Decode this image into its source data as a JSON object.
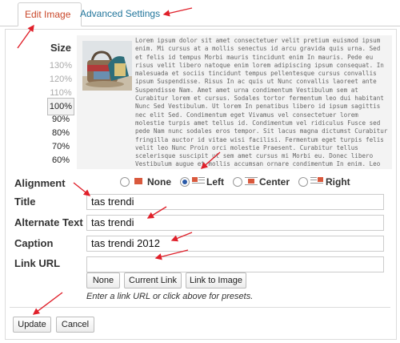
{
  "tabs": [
    {
      "label": "Edit Image",
      "active": true
    },
    {
      "label": "Advanced Settings",
      "active": false
    }
  ],
  "size": {
    "label": "Size",
    "options": [
      "130%",
      "120%",
      "110%",
      "100%",
      "90%",
      "80%",
      "70%",
      "60%"
    ],
    "selected": "100%"
  },
  "preview": {
    "text": "Lorem ipsum dolor sit amet consectetuer velit pretium euismod ipsum enim. Mi cursus at a mollis senectus id arcu gravida quis urna. Sed et felis id tempus Morbi mauris tincidunt enim In mauris. Pede eu risus velit libero natoque enim lorem adipiscing ipsum consequat. In malesuada et sociis tincidunt tempus pellentesque cursus convallis ipsum Suspendisse. Risus In ac quis ut Nunc convallis laoreet ante Suspendisse Nam. Amet amet urna condimentum Vestibulum sem at Curabitur lorem et cursus. Sodales tortor fermentum leo dui habitant Nunc Sed Vestibulum. Ut lorem In penatibus libero id ipsum sagittis nec elit Sed. Condimentum eget Vivamus vel consectetuer lorem molestie turpis amet tellus id. Condimentum vel ridiculus Fusce sed pede Nam nunc sodales eros tempor. Sit lacus magna dictumst Curabitur fringilla auctor id vitae wisi facilisi. Fermentum eget turpis felis velit leo Nunc Proin orci molestie Praesent. Curabitur tellus scelerisque suscipit ut sem amet cursus mi Morbi eu. Donec libero Vestibulum augue et mollis accumsan ornare condimentum In enim. Leo eget ac consectetuer quis condimentum malesuada. Condimentum commodo et Lorem fringilla malesuada libero volutpat sem tellus enim. Tincidunt sed at Aenean nec quis Curabitur Nam Nulla ut. Auctor leo In aliquet Curabitur eros et velit"
  },
  "alignment": {
    "label": "Alignment",
    "options": [
      "None",
      "Left",
      "Center",
      "Right"
    ],
    "selected": "Left"
  },
  "fields": {
    "title": {
      "label": "Title",
      "value": "tas trendi"
    },
    "alt": {
      "label": "Alternate Text",
      "value": "tas trendi"
    },
    "caption": {
      "label": "Caption",
      "value": "tas trendi 2012"
    },
    "link": {
      "label": "Link URL",
      "value": ""
    }
  },
  "link_buttons": [
    "None",
    "Current Link",
    "Link to Image"
  ],
  "hint": "Enter a link URL or click above for presets.",
  "actions": {
    "update": "Update",
    "cancel": "Cancel"
  },
  "colors": {
    "annotation_arrow": "#e0202a",
    "active_tab": "#c9472a",
    "link_tab": "#21759b"
  }
}
